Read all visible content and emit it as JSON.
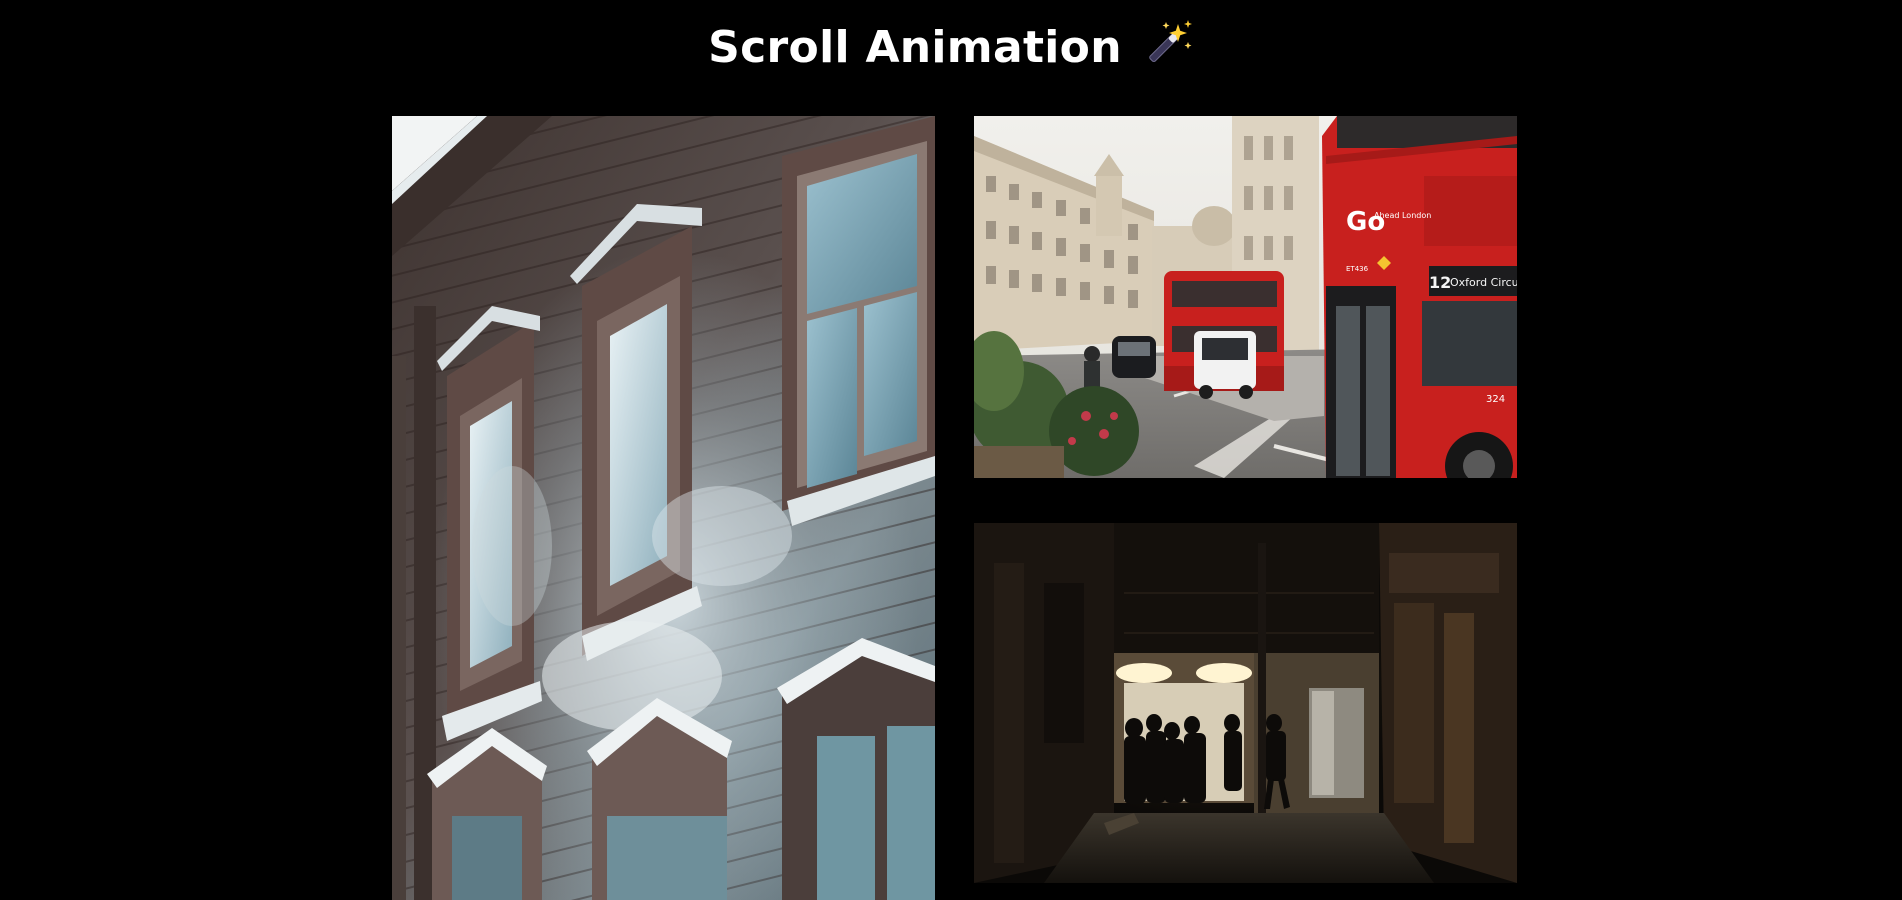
{
  "header": {
    "title": "Scroll Animation",
    "icon": "magic-wand-sparkles-icon"
  },
  "gallery": {
    "images": [
      {
        "subject": "frosted-wooden-house-photo"
      },
      {
        "subject": "london-red-bus-street-photo"
      },
      {
        "subject": "dark-alley-night-photo"
      }
    ],
    "bus_sign": {
      "brand": "Go",
      "brand_sub": "Ahead London",
      "route_number": "12",
      "destination": "Oxford Circus",
      "fleet_code": "ET436",
      "side_number": "324"
    }
  },
  "colors": {
    "background": "#000000",
    "title_text": "#ffffff",
    "bus_red": "#c8201e"
  }
}
